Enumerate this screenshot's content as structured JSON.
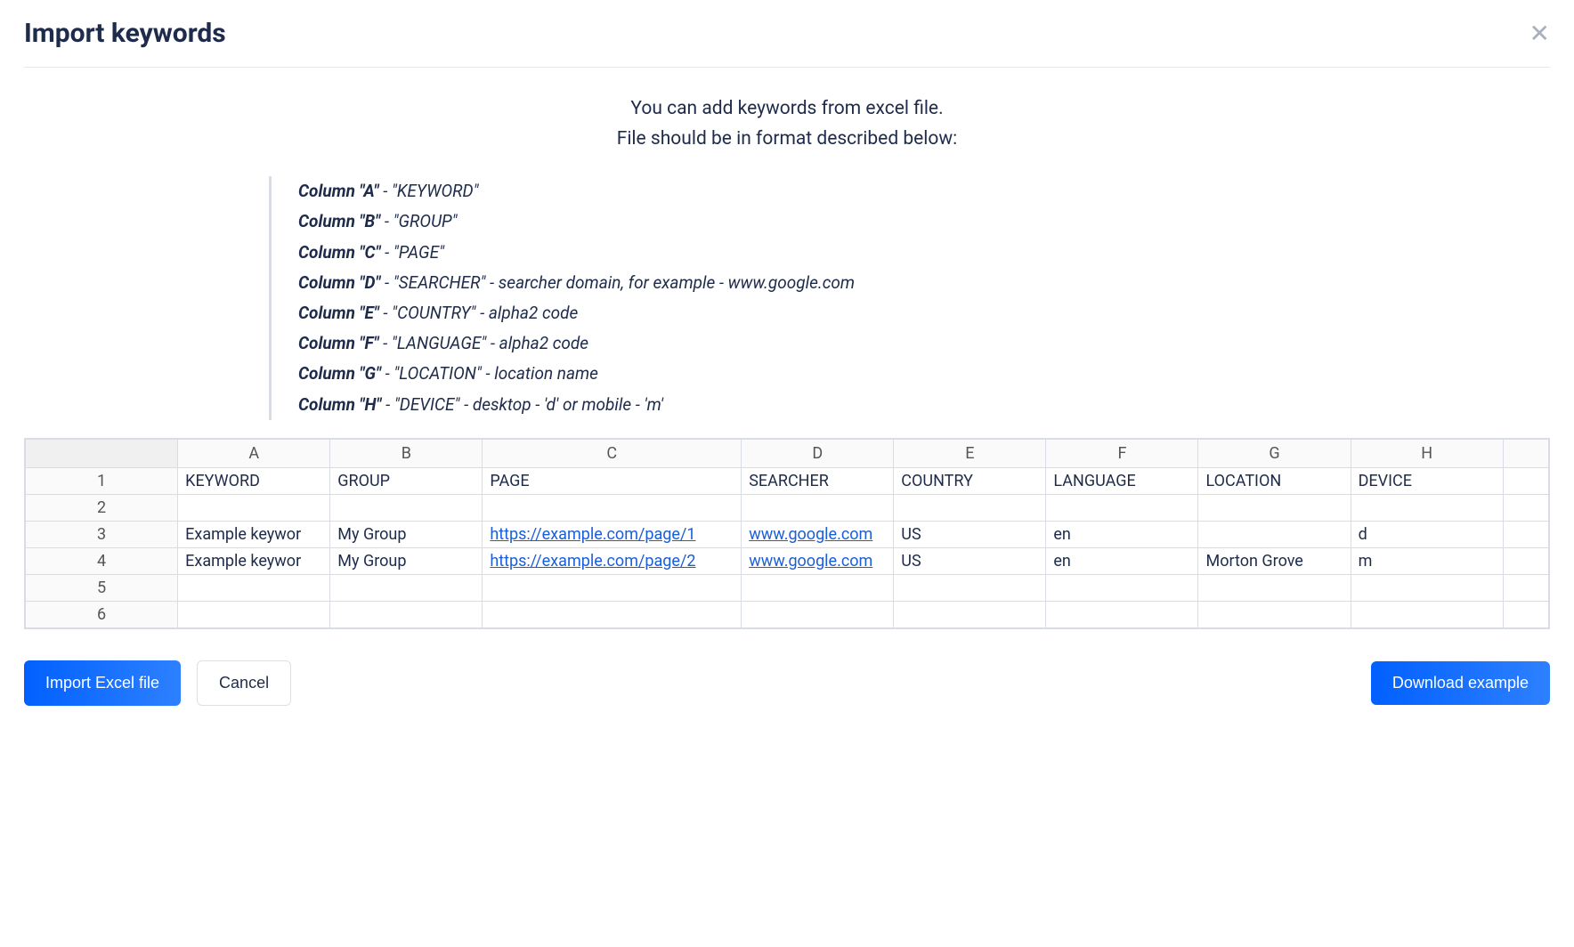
{
  "header": {
    "title": "Import keywords"
  },
  "intro": {
    "line1": "You can add keywords from excel file.",
    "line2": "File should be in format described below:"
  },
  "columns": [
    {
      "label": "Column \"A\"",
      "desc": " - \"KEYWORD\""
    },
    {
      "label": "Column \"B\"",
      "desc": " - \"GROUP\""
    },
    {
      "label": "Column \"C\"",
      "desc": " - \"PAGE\""
    },
    {
      "label": "Column \"D\"",
      "desc": " - \"SEARCHER\" - searcher domain, for example - www.google.com"
    },
    {
      "label": "Column \"E\"",
      "desc": " - \"COUNTRY\" - alpha2 code"
    },
    {
      "label": "Column \"F\"",
      "desc": " - \"LANGUAGE\" - alpha2 code"
    },
    {
      "label": "Column \"G\"",
      "desc": " - \"LOCATION\" - location name"
    },
    {
      "label": "Column \"H\"",
      "desc": " - \"DEVICE\" - desktop - 'd' or mobile - 'm'"
    }
  ],
  "sheet": {
    "headers": [
      "A",
      "B",
      "C",
      "D",
      "E",
      "F",
      "G",
      "H"
    ],
    "rows": [
      {
        "num": "1",
        "cells": [
          "KEYWORD",
          "GROUP",
          "PAGE",
          "SEARCHER",
          "COUNTRY",
          "LANGUAGE",
          "LOCATION",
          "DEVICE"
        ],
        "links": []
      },
      {
        "num": "2",
        "cells": [
          "",
          "",
          "",
          "",
          "",
          "",
          "",
          ""
        ],
        "links": []
      },
      {
        "num": "3",
        "cells": [
          "Example keywor",
          "My Group",
          "https://example.com/page/1",
          "www.google.com",
          "US",
          "en",
          "",
          "d"
        ],
        "links": [
          2,
          3
        ]
      },
      {
        "num": "4",
        "cells": [
          "Example keywor",
          "My Group",
          "https://example.com/page/2",
          "www.google.com",
          "US",
          "en",
          "Morton Grove",
          "m"
        ],
        "links": [
          2,
          3
        ]
      },
      {
        "num": "5",
        "cells": [
          "",
          "",
          "",
          "",
          "",
          "",
          "",
          ""
        ],
        "links": []
      },
      {
        "num": "6",
        "cells": [
          "",
          "",
          "",
          "",
          "",
          "",
          "",
          ""
        ],
        "links": []
      }
    ]
  },
  "buttons": {
    "import": "Import Excel file",
    "cancel": "Cancel",
    "download": "Download example"
  }
}
